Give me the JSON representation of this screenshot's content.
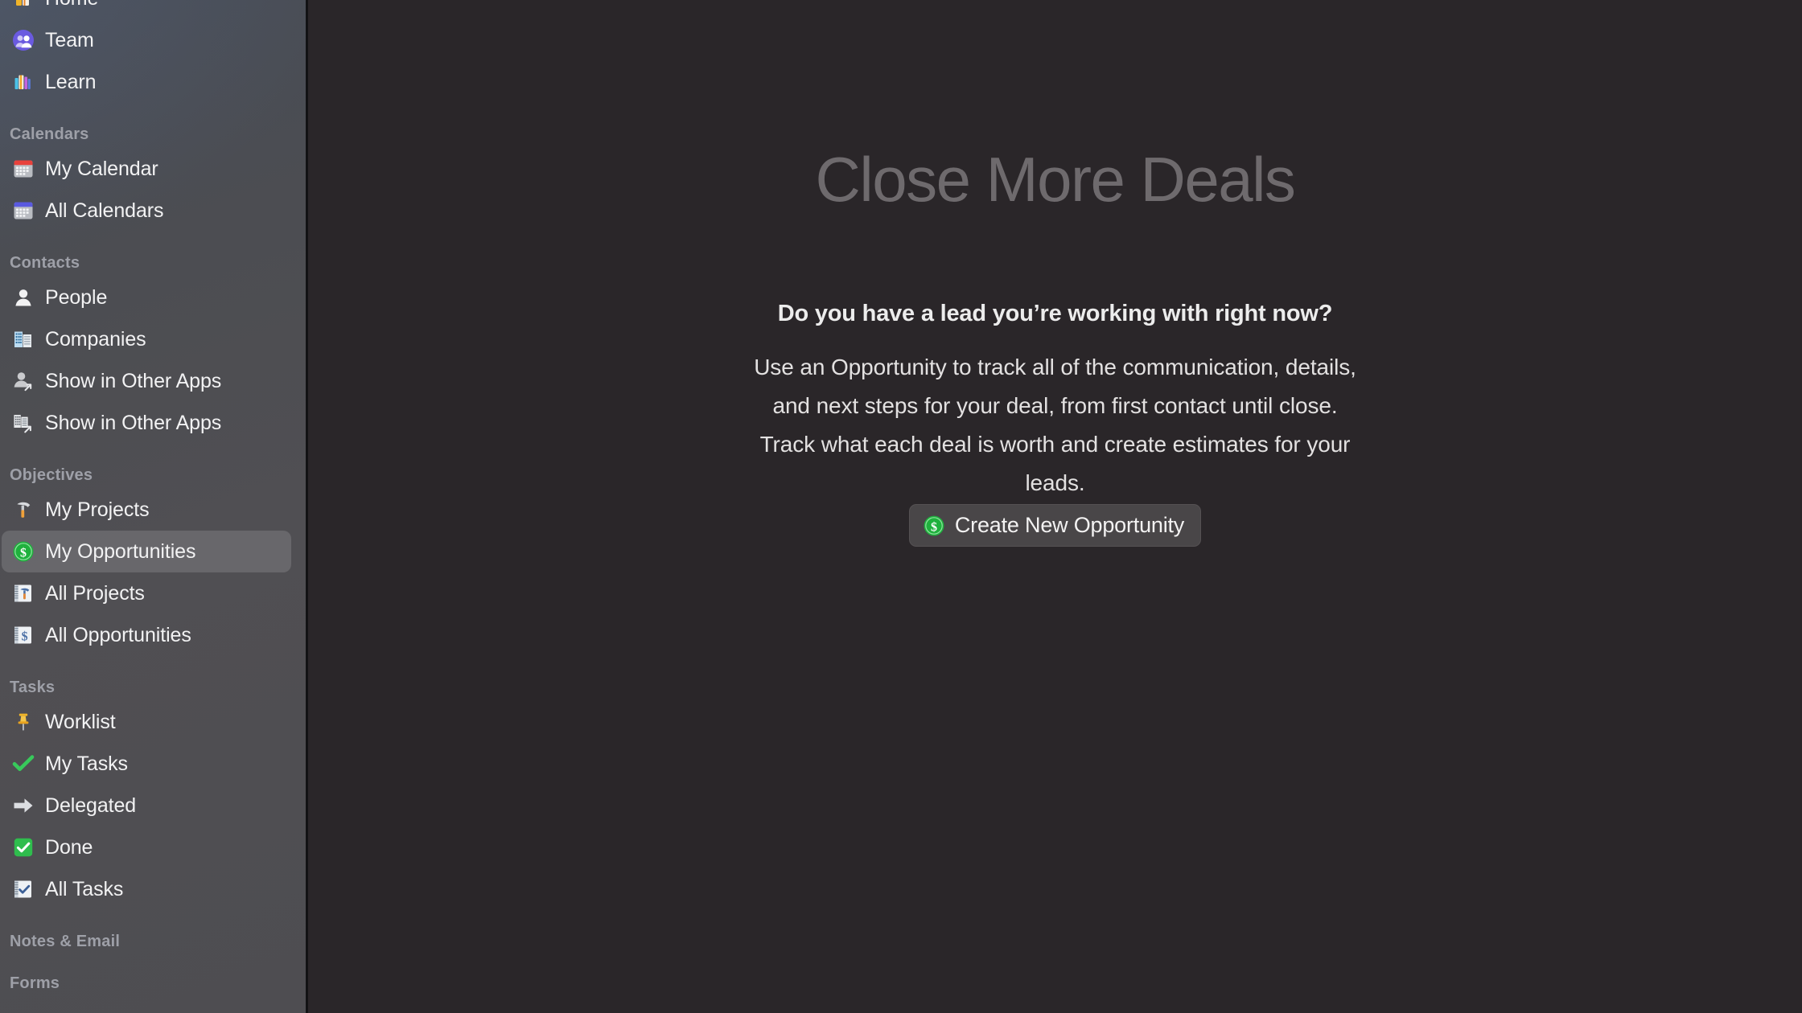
{
  "app": {
    "accent_green": "#2ebd4e",
    "sidebar_bg": "#4e4d51",
    "content_bg": "#2a2629",
    "selected_item": "My Opportunities"
  },
  "sidebar": {
    "sections": [
      {
        "header": null,
        "items": [
          {
            "label": "Home",
            "icon": "home-books-icon"
          },
          {
            "label": "Team",
            "icon": "team-people-circle-icon"
          },
          {
            "label": "Learn",
            "icon": "learn-books-icon"
          }
        ]
      },
      {
        "header": "Calendars",
        "items": [
          {
            "label": "My Calendar",
            "icon": "calendar-red-icon"
          },
          {
            "label": "All Calendars",
            "icon": "calendar-blue-icon"
          }
        ]
      },
      {
        "header": "Contacts",
        "items": [
          {
            "label": "People",
            "icon": "person-icon"
          },
          {
            "label": "Companies",
            "icon": "building-icon"
          },
          {
            "label": "Show in Other Apps",
            "icon": "person-share-icon"
          },
          {
            "label": "Show in Other Apps",
            "icon": "building-share-icon"
          }
        ]
      },
      {
        "header": "Objectives",
        "items": [
          {
            "label": "My Projects",
            "icon": "hammer-icon"
          },
          {
            "label": "My Opportunities",
            "icon": "money-bag-green-icon"
          },
          {
            "label": "All Projects",
            "icon": "notebook-hammer-icon"
          },
          {
            "label": "All Opportunities",
            "icon": "notebook-dollar-icon"
          }
        ]
      },
      {
        "header": "Tasks",
        "items": [
          {
            "label": "Worklist",
            "icon": "pushpin-icon"
          },
          {
            "label": "My Tasks",
            "icon": "green-check-icon"
          },
          {
            "label": "Delegated",
            "icon": "right-arrow-icon"
          },
          {
            "label": "Done",
            "icon": "checkbox-checked-green-icon"
          },
          {
            "label": "All Tasks",
            "icon": "notebook-check-icon"
          }
        ]
      },
      {
        "header": "Notes & Email",
        "items": []
      },
      {
        "header": "Forms",
        "items": []
      }
    ]
  },
  "main": {
    "hero_title": "Close More Deals",
    "question": "Do you have a lead you’re working with right now?",
    "description": "Use an Opportunity to track all of the communication, details, and next steps for your deal, from first contact until close. Track what each deal is worth and create estimates for your leads.",
    "cta": {
      "label": "Create New Opportunity",
      "icon": "money-badge-green-icon"
    }
  }
}
